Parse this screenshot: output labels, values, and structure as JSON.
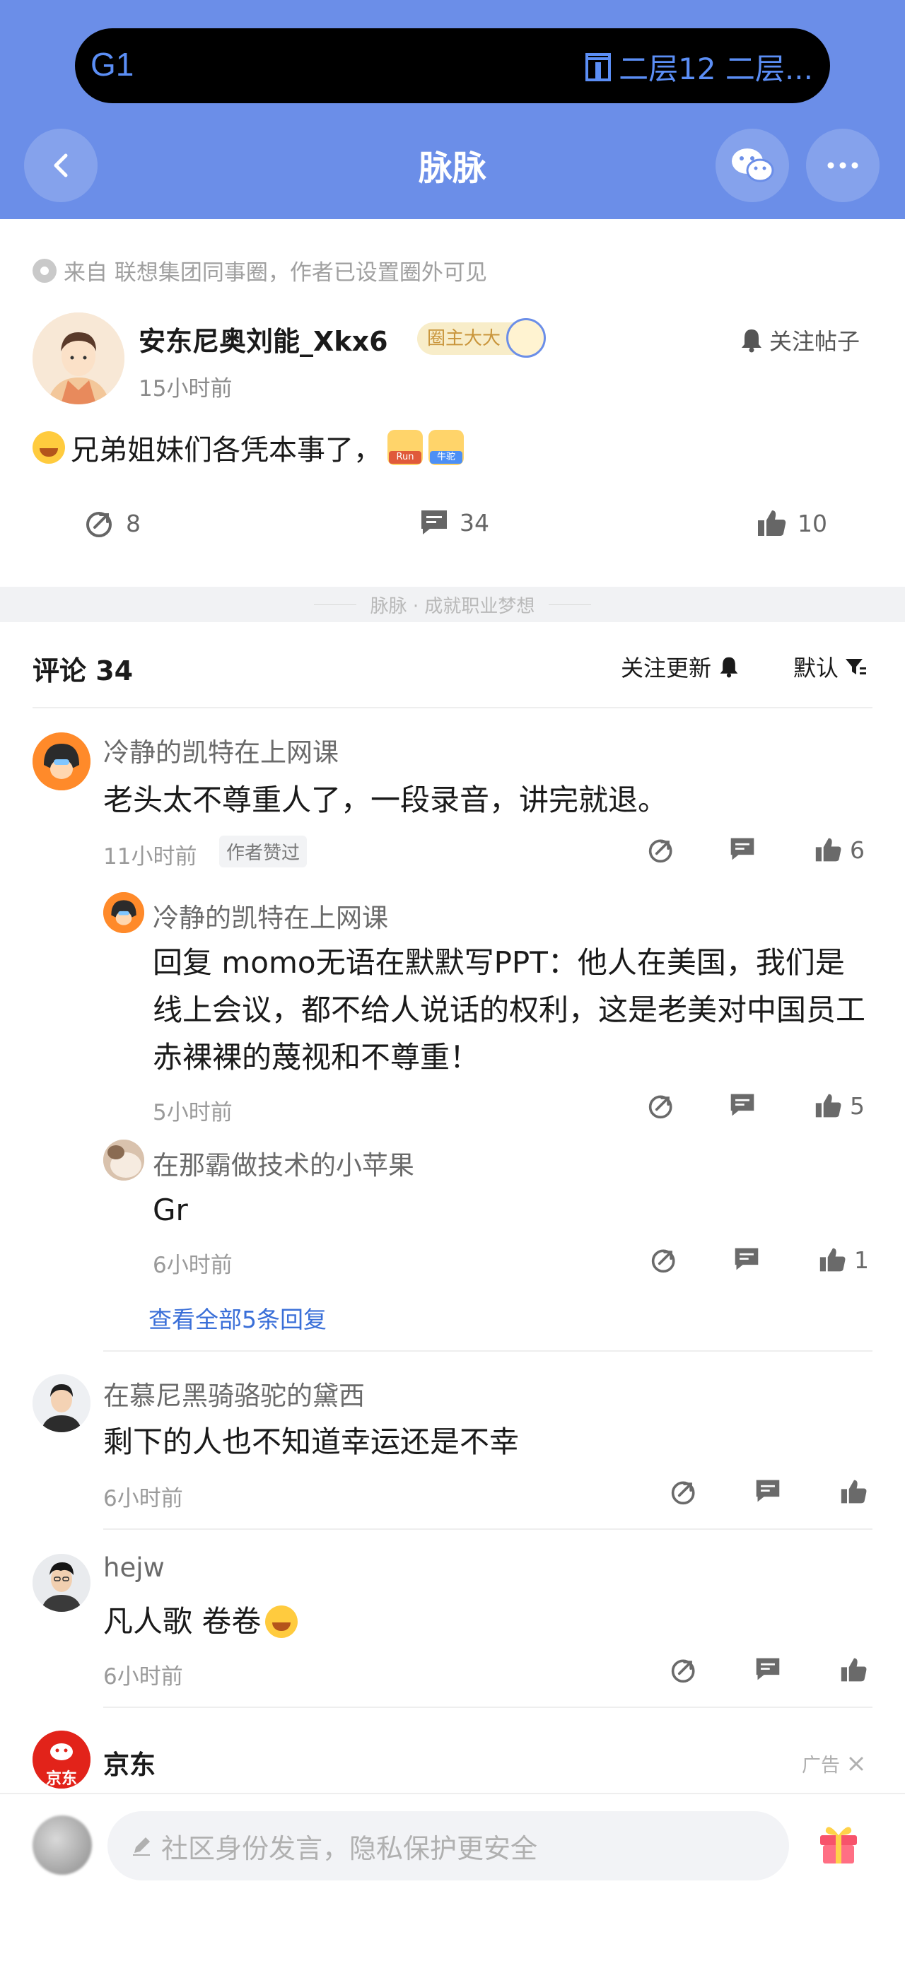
{
  "status_bar": {
    "left": "G1",
    "right": "二层12 二层..."
  },
  "header": {
    "title": "脉脉"
  },
  "post": {
    "source": "来自 联想集团同事圈，作者已设置圈外可见",
    "author_name": "安东尼奥刘能_Xkx6",
    "author_badge": "圈主大大",
    "time": "15小时前",
    "follow_label": "关注帖子",
    "text": "兄弟姐妹们各凭本事了，",
    "sticker_labels": [
      "Run",
      "牛驼"
    ],
    "share_count": "8",
    "comment_count": "34",
    "like_count": "10"
  },
  "slogan": "脉脉 · 成就职业梦想",
  "comments_header": {
    "title": "评论 34",
    "follow_updates": "关注更新",
    "sort": "默认"
  },
  "comments": [
    {
      "name": "冷静的凯特在上网课",
      "text": "老头太不尊重人了，一段录音，讲完就退。",
      "time": "11小时前",
      "tag": "作者赞过",
      "likes": "6",
      "replies": [
        {
          "name": "冷静的凯特在上网课",
          "text": "回复 momo无语在默默写PPT：他人在美国，我们是线上会议，都不给人说话的权利，这是老美对中国员工赤裸裸的蔑视和不尊重！",
          "time": "5小时前",
          "likes": "5"
        },
        {
          "name": "在那霸做技术的小苹果",
          "text": "Gr",
          "time": "6小时前",
          "likes": "1"
        }
      ],
      "see_all": "查看全部5条回复"
    },
    {
      "name": "在慕尼黑骑骆驼的黛西",
      "text": "剩下的人也不知道幸运还是不幸",
      "time": "6小时前"
    },
    {
      "name": "hejw",
      "text": "凡人歌 卷卷",
      "time": "6小时前"
    }
  ],
  "ad": {
    "name": "京东",
    "avatar_text": "京东",
    "label": "广告"
  },
  "bottom_bar": {
    "placeholder": "社区身份发言，隐私保护更安全"
  },
  "colors": {
    "header_bg": "#6b8ee8",
    "link": "#3a6fd8",
    "status_text": "#5b8ef5"
  }
}
